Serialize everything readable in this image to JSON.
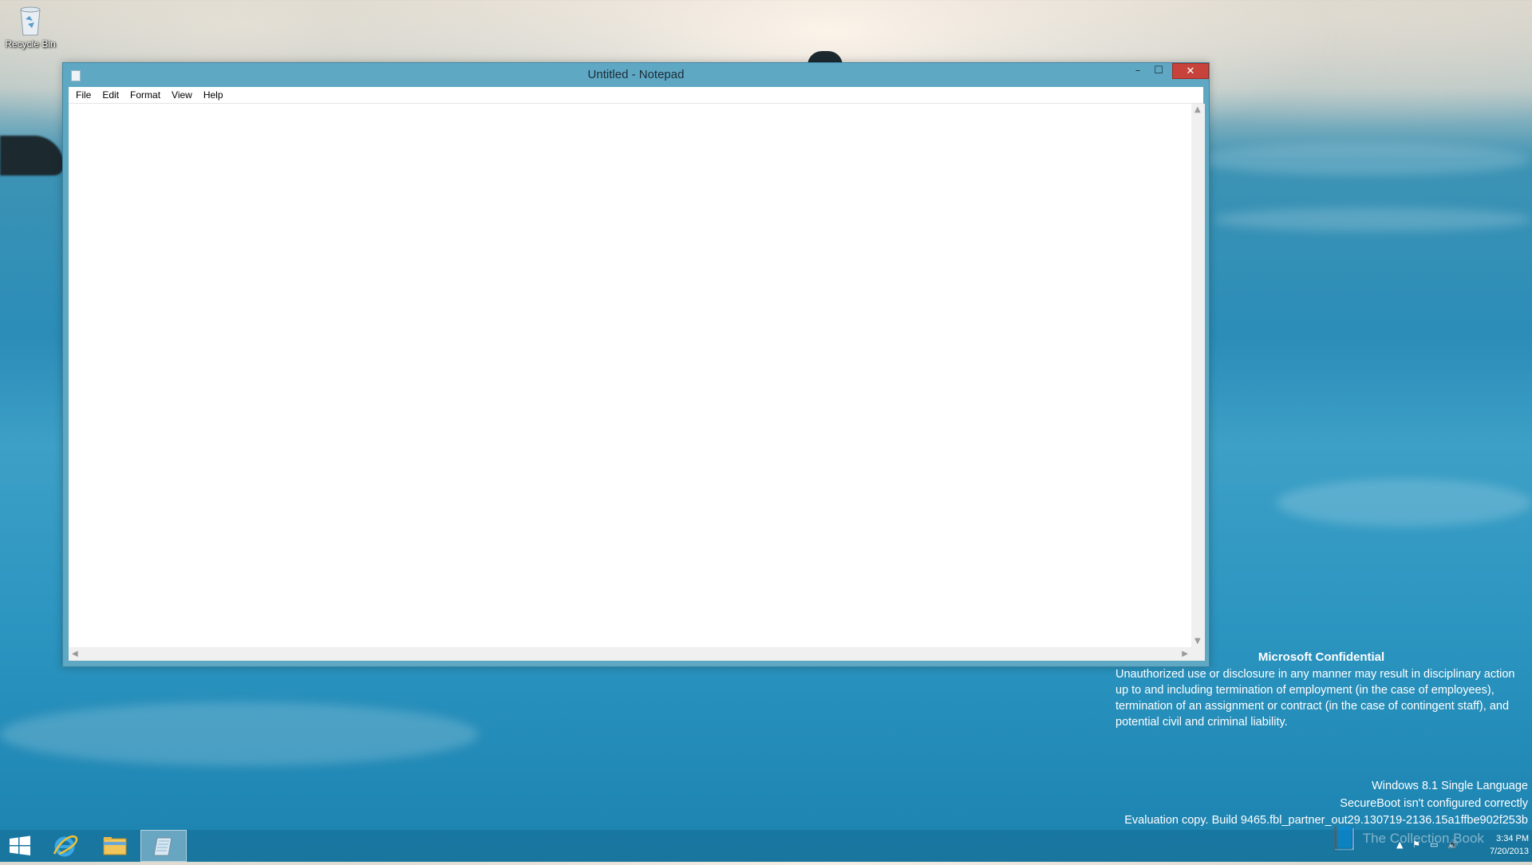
{
  "desktop": {
    "recycle_bin_label": "Recycle Bin"
  },
  "window": {
    "title": "Untitled - Notepad",
    "controls": {
      "minimize": "–",
      "maximize": "☐",
      "close": "✕"
    },
    "menu": [
      "File",
      "Edit",
      "Format",
      "View",
      "Help"
    ],
    "editor_content": ""
  },
  "notice": {
    "heading": "Microsoft Confidential",
    "body_lines": [
      "Unauthorized use or disclosure in any manner may result in disciplinary action",
      "up to and including termination of employment (in the case of employees),",
      "termination of an assignment or contract (in the case of contingent staff), and",
      "potential civil and criminal liability."
    ]
  },
  "build_info": [
    "Windows 8.1 Single Language",
    "SecureBoot isn't configured correctly",
    "Evaluation copy. Build 9465.fbl_partner_out29.130719-2136.15a1ffbe902f253b"
  ],
  "watermark": "The Collection Book",
  "taskbar": {
    "apps": [
      "start-icon",
      "internet-explorer-icon",
      "file-explorer-icon",
      "notepad-icon"
    ],
    "clock": {
      "time": "3:34 PM",
      "date": "7/20/2013"
    }
  },
  "colors": {
    "titlebar": "#5fa8c4",
    "close_button": "#c7423a",
    "taskbar": "#1f7ea8"
  }
}
